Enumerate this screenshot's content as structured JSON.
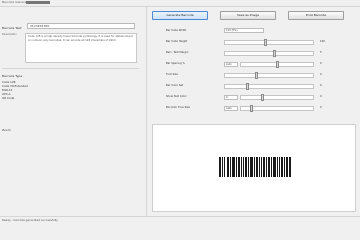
{
  "window": {
    "title": "Barcode Generator"
  },
  "left": {
    "text_label": "Barcode Text:",
    "text_value": "0123456789",
    "description_label": "Description",
    "description": "Code 128 is a high-density linear barcode symbology. It is used for alphanumeric or numeric-only barcodes. It can encode all 128 characters of ASCII.",
    "type_label": "Barcode Type",
    "types": [
      "Code 128",
      "Code 39 Extended",
      "EAN-13",
      "UPC-A",
      "QR Code"
    ],
    "zoom_label": "Zoom"
  },
  "toolbar": {
    "generate_label": "Generate Barcode",
    "save_label": "Save as Image",
    "print_label": "Print Barcode"
  },
  "params": [
    {
      "label": "Bar Code Width",
      "kind": "text",
      "value": "123 (5%)"
    },
    {
      "label": "Bar Code Height",
      "kind": "slider",
      "level": 0.45,
      "value": "100"
    },
    {
      "label": "Barc. Text Margin",
      "kind": "slider",
      "level": 0.55,
      "value": "5"
    },
    {
      "label": "Bar Spacing %",
      "kind": "select-slider",
      "select": "Auto",
      "level": 0.5,
      "value": "0"
    },
    {
      "label": "Font Size",
      "kind": "slider",
      "level": 0.35,
      "value": "0"
    },
    {
      "label": "Bar Color Set",
      "kind": "slider",
      "level": 0.25,
      "value": "0"
    },
    {
      "label": "Show Text Color",
      "kind": "select-slider",
      "select": "0",
      "level": 0.3,
      "value": "0"
    },
    {
      "label": "BG Color Fore Size",
      "kind": "select-slider",
      "select": "Auto",
      "level": 0.15,
      "value": "0"
    }
  ],
  "status": {
    "text": "Ready - barcode generated successfully"
  },
  "colors": {
    "accent": "#4a8ad6",
    "bar": "#1a1a1a"
  }
}
